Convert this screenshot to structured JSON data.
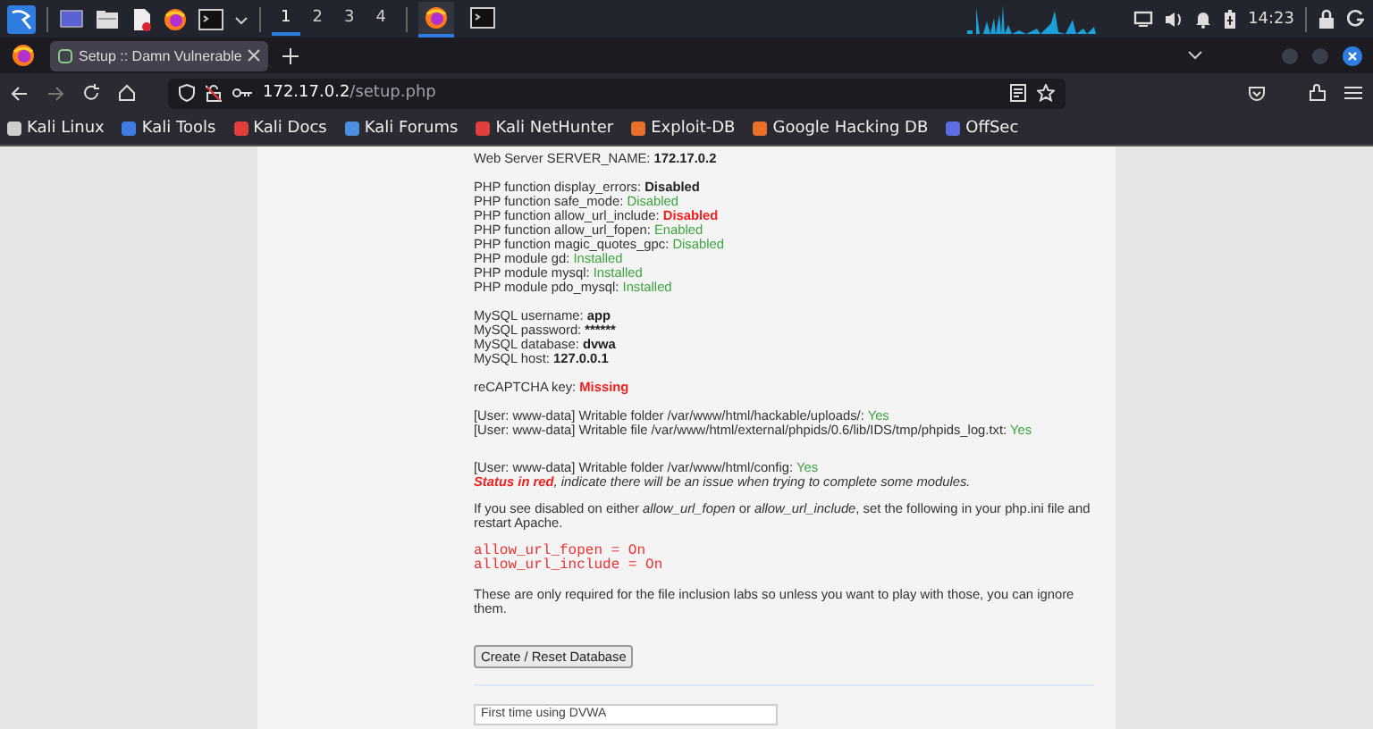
{
  "taskbar": {
    "workspaces": [
      {
        "label": "1",
        "selected": true
      },
      {
        "label": "2",
        "selected": false
      },
      {
        "label": "3",
        "selected": false
      },
      {
        "label": "4",
        "selected": false
      }
    ],
    "clock": "14:23"
  },
  "browser": {
    "tab": {
      "title": "Setup :: Damn Vulnerable"
    },
    "url": {
      "host": "172.17.0.2",
      "path": "/setup.php"
    },
    "bookmarks": [
      {
        "label": "Kali Linux",
        "color": "#cfcfcf"
      },
      {
        "label": "Kali Tools",
        "color": "#3d7be0"
      },
      {
        "label": "Kali Docs",
        "color": "#e0403d"
      },
      {
        "label": "Kali Forums",
        "color": "#4a8fe0"
      },
      {
        "label": "Kali NetHunter",
        "color": "#e0403d"
      },
      {
        "label": "Exploit-DB",
        "color": "#e8702a"
      },
      {
        "label": "Google Hacking DB",
        "color": "#e8702a"
      },
      {
        "label": "OffSec",
        "color": "#5b6ee0"
      }
    ]
  },
  "page": {
    "groups": [
      [
        {
          "label": "Web Server SERVER_NAME:",
          "value": "172.17.0.2",
          "kind": "plain"
        }
      ],
      [
        {
          "label": "PHP function display_errors:",
          "value": "Disabled",
          "kind": "plain"
        },
        {
          "label": "PHP function safe_mode:",
          "value": "Disabled",
          "kind": "ok"
        },
        {
          "label": "PHP function allow_url_include:",
          "value": "Disabled",
          "kind": "bad"
        },
        {
          "label": "PHP function allow_url_fopen:",
          "value": "Enabled",
          "kind": "ok"
        },
        {
          "label": "PHP function magic_quotes_gpc:",
          "value": "Disabled",
          "kind": "ok"
        },
        {
          "label": "PHP module gd:",
          "value": "Installed",
          "kind": "ok"
        },
        {
          "label": "PHP module mysql:",
          "value": "Installed",
          "kind": "ok"
        },
        {
          "label": "PHP module pdo_mysql:",
          "value": "Installed",
          "kind": "ok"
        }
      ],
      [
        {
          "label": "MySQL username:",
          "value": "app",
          "kind": "plain"
        },
        {
          "label": "MySQL password:",
          "value": "******",
          "kind": "plain"
        },
        {
          "label": "MySQL database:",
          "value": "dvwa",
          "kind": "plain"
        },
        {
          "label": "MySQL host:",
          "value": "127.0.0.1",
          "kind": "plain"
        }
      ],
      [
        {
          "label": "reCAPTCHA key:",
          "value": "Missing",
          "kind": "bad"
        }
      ],
      [
        {
          "label": "[User: www-data] Writable folder /var/www/html/hackable/uploads/:",
          "value": "Yes",
          "kind": "ok"
        },
        {
          "label": "[User: www-data] Writable file /var/www/html/external/phpids/0.6/lib/IDS/tmp/phpids_log.txt:",
          "value": "Yes",
          "kind": "ok"
        }
      ],
      [
        {
          "label": "[User: www-data] Writable folder /var/www/html/config:",
          "value": "Yes",
          "kind": "ok"
        }
      ]
    ],
    "status_note": "**Status in red**, indicate there will be an issue when trying to complete some modules.",
    "instructions": "If you see disabled on either *allow_url_fopen* or *allow_url_include*, set the following in your php.ini file and restart Apache.",
    "code": [
      "allow_url_fopen = On",
      "allow_url_include = On"
    ],
    "footnote": "These are only required for the file inclusion labs so unless you want to play with those, you can ignore them.",
    "button": "Create / Reset Database",
    "info_box": "First time using DVWA"
  }
}
